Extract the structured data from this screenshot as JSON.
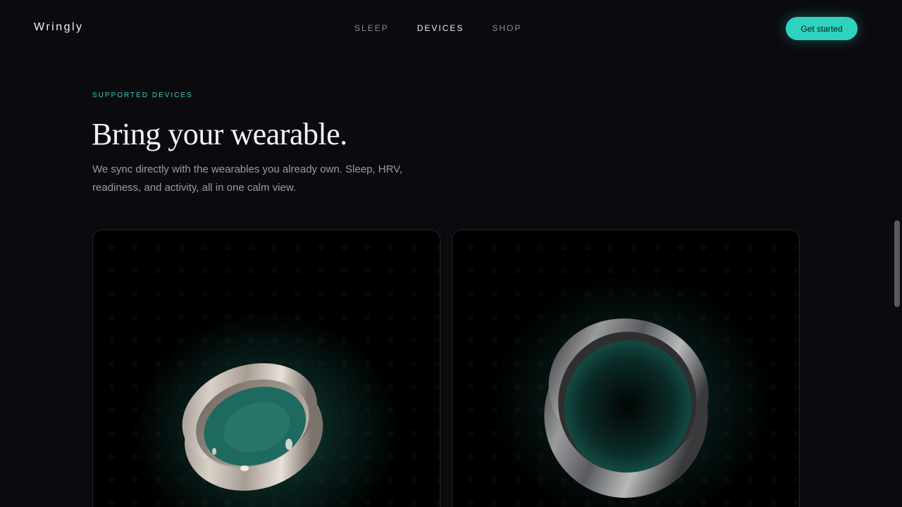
{
  "header": {
    "brand": "Wringly",
    "nav": [
      "SLEEP",
      "DEVICES",
      "SHOP"
    ],
    "active_nav": "DEVICES",
    "cta_label": "Get started"
  },
  "section": {
    "eyebrow": "SUPPORTED DEVICES",
    "title": "Bring your wearable.",
    "description": "We sync directly with the wearables you already own. Sleep, HRV, readiness, and activity, all in one calm view."
  },
  "cards": [
    {
      "ring_color": "silver"
    },
    {
      "ring_color": "graphite"
    }
  ],
  "colors": {
    "accent": "#2ed3bf",
    "background": "#0b0b0f"
  }
}
